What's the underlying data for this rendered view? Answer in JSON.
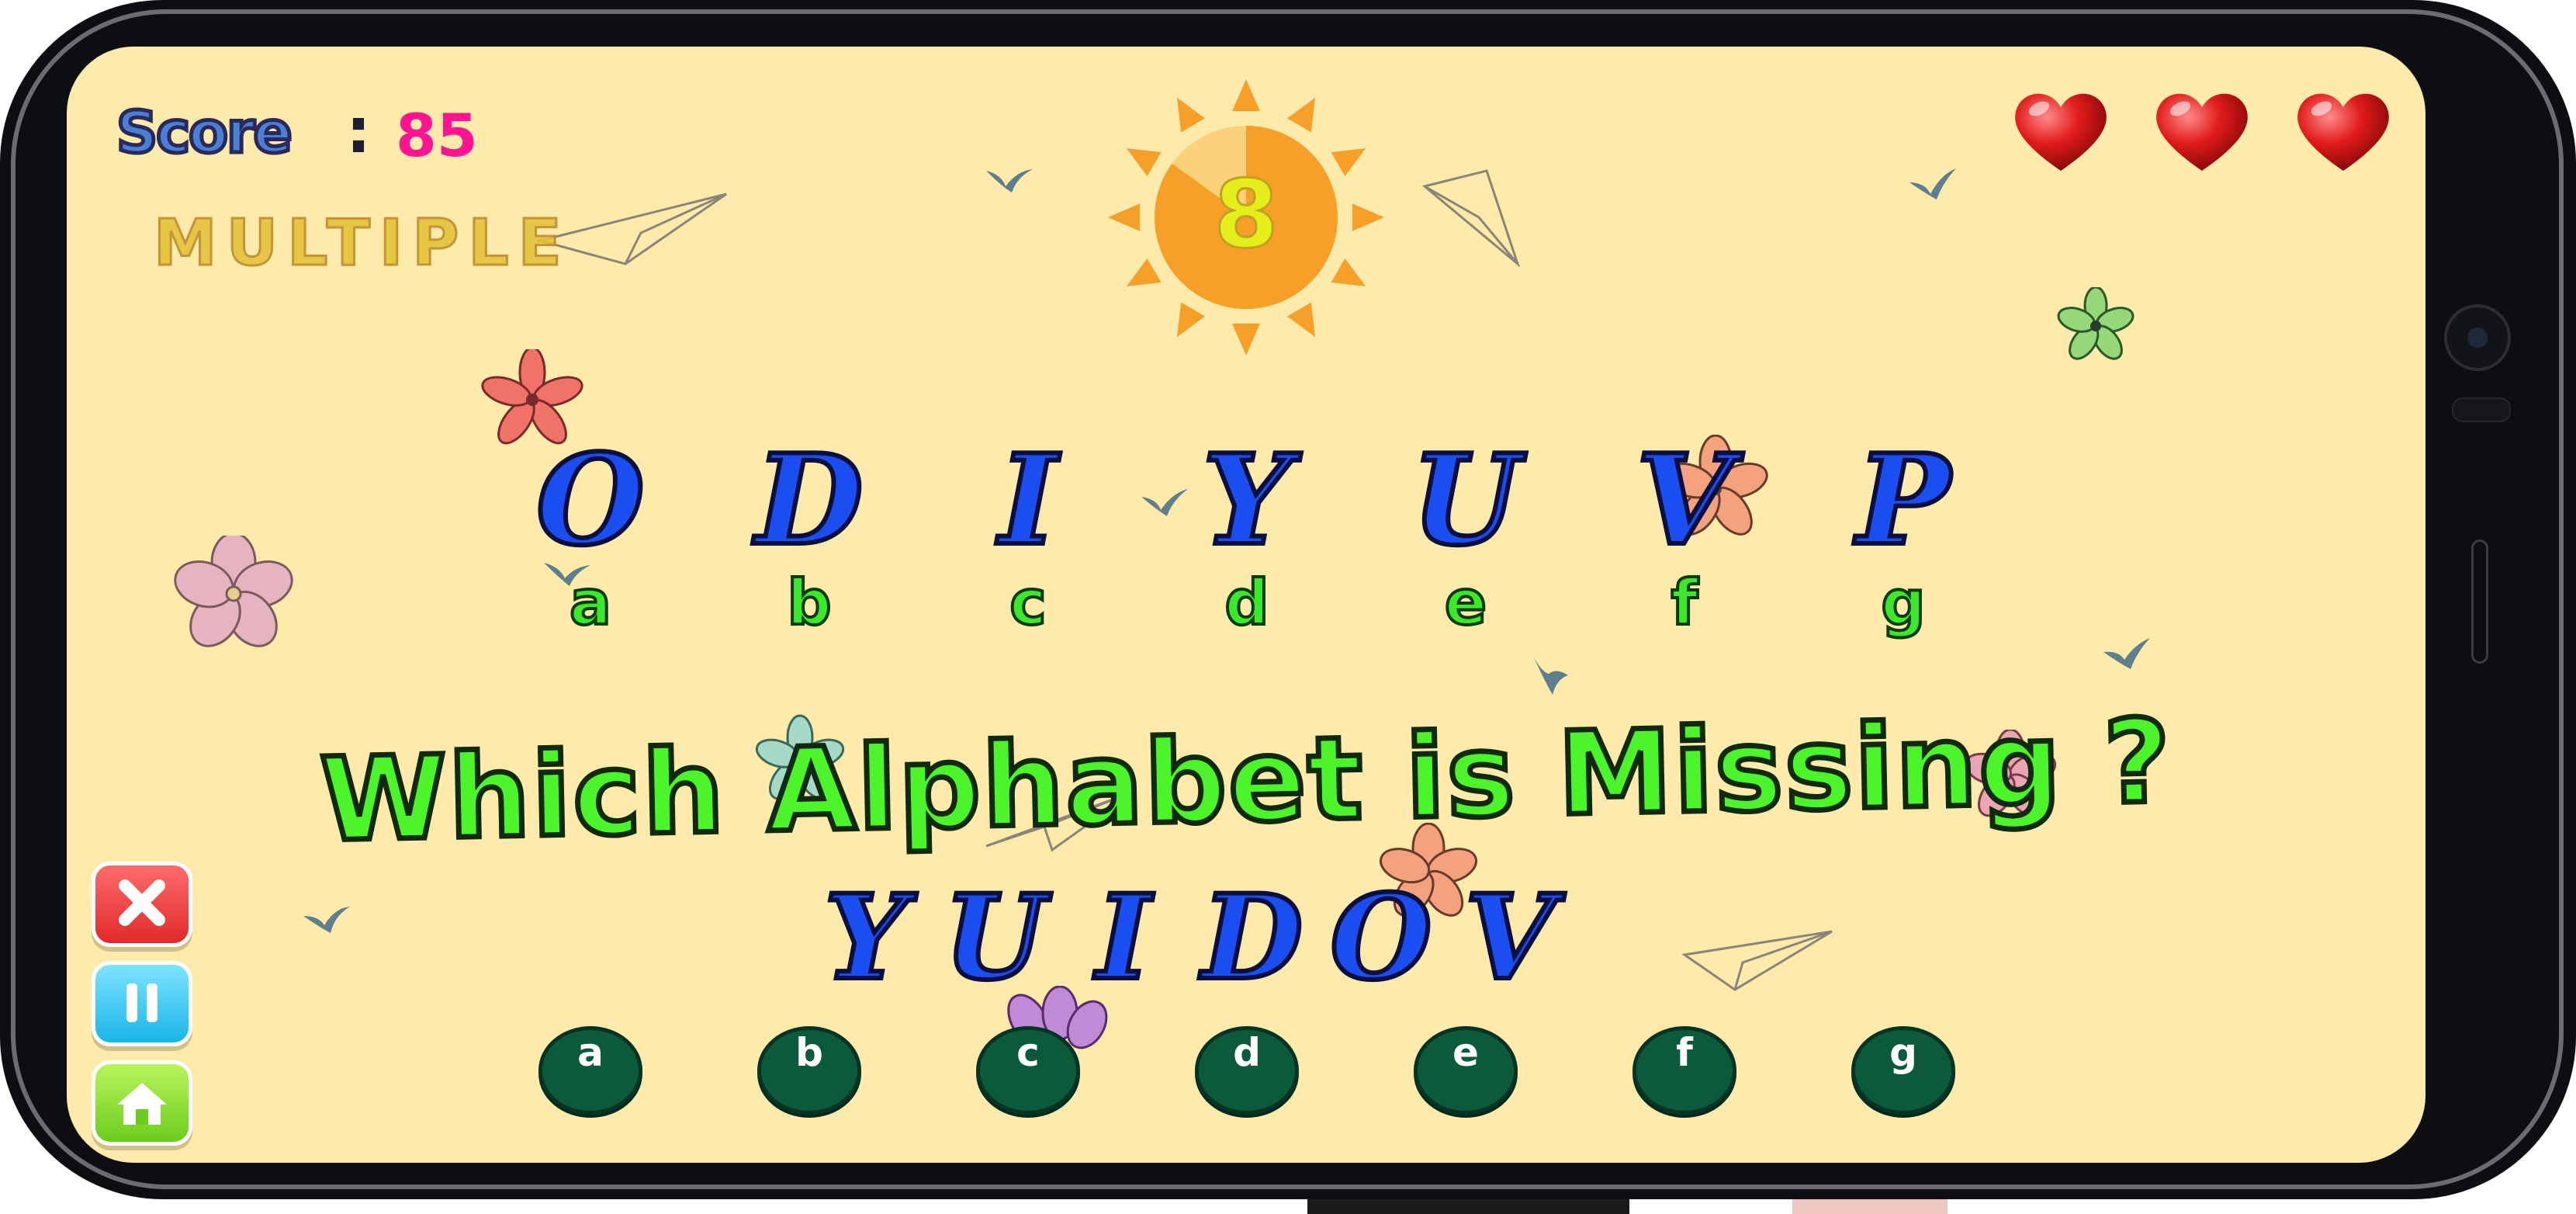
{
  "hud": {
    "score_label": "Score",
    "score_separator": ":",
    "score_value": "85",
    "mode_label": "MULTIPLE",
    "lives": 3,
    "timer_value": "8",
    "timer_progress": 0.85
  },
  "puzzle": {
    "sequence": [
      "O",
      "D",
      "I",
      "Y",
      "U",
      "V",
      "P"
    ],
    "sequence_labels": [
      "a",
      "b",
      "c",
      "d",
      "e",
      "f",
      "g"
    ],
    "question": "Which Alphabet is Missing ?",
    "shuffled": [
      "Y",
      "U",
      "I",
      "D",
      "O",
      "V"
    ]
  },
  "options": [
    "a",
    "b",
    "c",
    "d",
    "e",
    "f",
    "g"
  ],
  "controls": {
    "close_icon": "close-icon",
    "pause_icon": "pause-icon",
    "home_icon": "home-icon"
  },
  "colors": {
    "background": "#feebab",
    "letter_blue": "#1a4ef0",
    "text_green": "#4cf52a",
    "score_pink": "#ff1493",
    "option_green": "#0c5a3c",
    "heart_red": "#e11b1b",
    "sun_orange": "#f6a02a"
  }
}
